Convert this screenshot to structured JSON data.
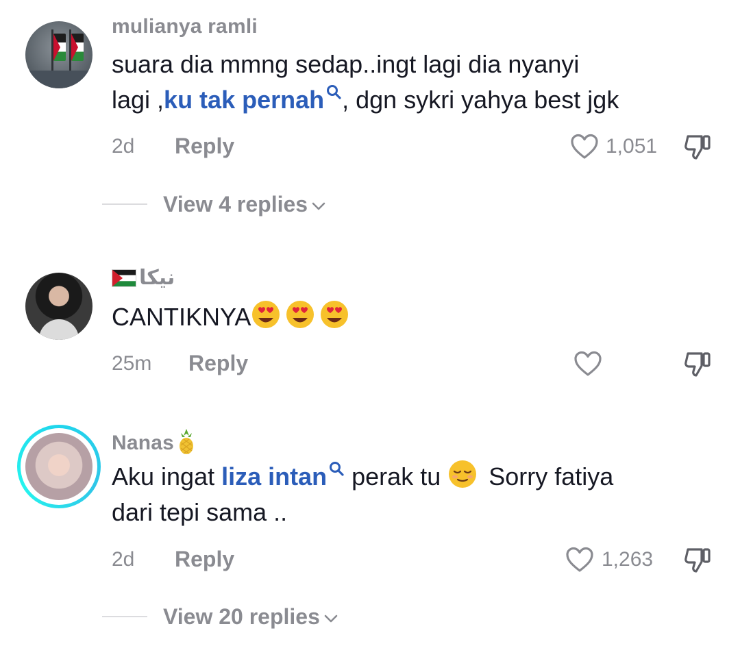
{
  "comments": [
    {
      "username": "mulianya ramli",
      "text_line1": "suara dia mmng sedap..ingt lagi dia nyanyi",
      "text_line2_prefix": "lagi ,",
      "link_text": "ku tak pernah",
      "text_line2_suffix": ", dgn sykri yahya best jgk",
      "time": "2d",
      "reply_label": "Reply",
      "like_count": "1,051",
      "view_replies": "View 4 replies"
    },
    {
      "username": "نيكا",
      "text": "CANTIKNYA",
      "emoji_count": 3,
      "time": "25m",
      "reply_label": "Reply",
      "like_count": ""
    },
    {
      "username": "Nanas",
      "text_line1_prefix": "Aku ingat ",
      "link_text": "liza intan",
      "text_line1_suffix": " perak tu ",
      "text_line1_end": " Sorry fatiya",
      "text_line2": "dari tepi sama ..",
      "time": "2d",
      "reply_label": "Reply",
      "like_count": "1,263",
      "view_replies": "View 20 replies"
    }
  ],
  "icons": {
    "like": "heart-outline-icon",
    "dislike": "thumbs-down-icon",
    "search": "search-icon",
    "chevron": "chevron-down-icon"
  },
  "colors": {
    "link": "#2b5db9",
    "muted": "#8a8b91",
    "text": "#161823",
    "ring": "#20d5ec"
  }
}
